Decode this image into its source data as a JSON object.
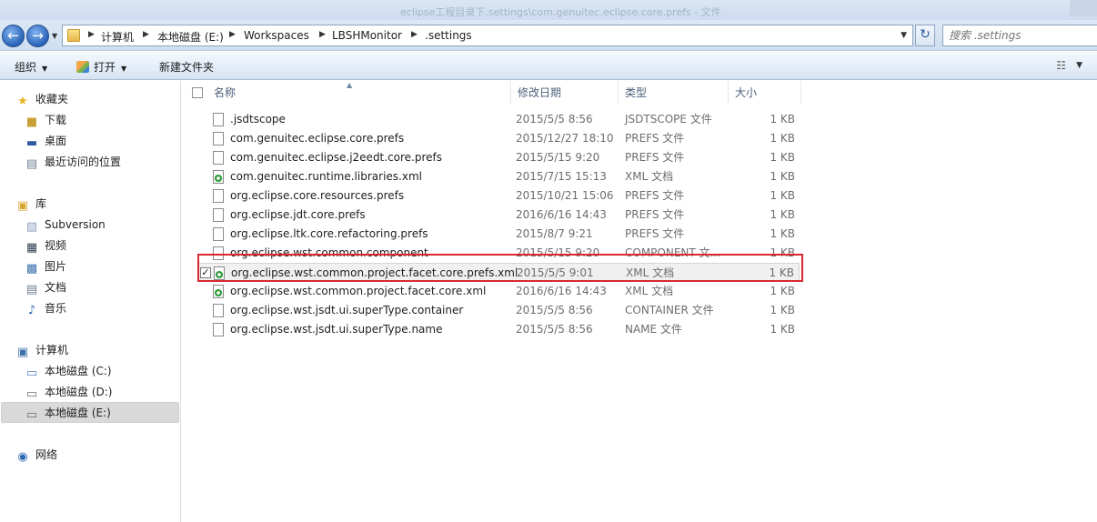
{
  "titlebar": {
    "title": "eclipse工程目录下.settings\\com.genuitec.eclipse.core.prefs - 文件"
  },
  "address": {
    "crumbs": [
      "计算机",
      "本地磁盘 (E:)",
      "Workspaces",
      "LBSHMonitor",
      ".settings"
    ]
  },
  "search": {
    "placeholder": "搜索 .settings"
  },
  "commands": {
    "organize": "组织",
    "open": "打开",
    "new_folder": "新建文件夹"
  },
  "nav": {
    "favorites": "收藏夹",
    "downloads": "下载",
    "desktop": "桌面",
    "recent": "最近访问的位置",
    "libraries": "库",
    "subversion": "Subversion",
    "videos": "视频",
    "pictures": "图片",
    "documents": "文档",
    "music": "音乐",
    "computer": "计算机",
    "drive_c": "本地磁盘 (C:)",
    "drive_d": "本地磁盘 (D:)",
    "drive_e": "本地磁盘 (E:)",
    "network": "网络"
  },
  "columns": {
    "name": "名称",
    "date": "修改日期",
    "type": "类型",
    "size": "大小"
  },
  "files": [
    {
      "name": ".jsdtscope",
      "date": "2015/5/5 8:56",
      "type": "JSDTSCOPE 文件",
      "size": "1 KB",
      "icon": "file-icon"
    },
    {
      "name": "com.genuitec.eclipse.core.prefs",
      "date": "2015/12/27 18:10",
      "type": "PREFS 文件",
      "size": "1 KB",
      "icon": "file-icon"
    },
    {
      "name": "com.genuitec.eclipse.j2eedt.core.prefs",
      "date": "2015/5/15 9:20",
      "type": "PREFS 文件",
      "size": "1 KB",
      "icon": "file-icon"
    },
    {
      "name": "com.genuitec.runtime.libraries.xml",
      "date": "2015/7/15 15:13",
      "type": "XML 文档",
      "size": "1 KB",
      "icon": "xml-icon"
    },
    {
      "name": "org.eclipse.core.resources.prefs",
      "date": "2015/10/21 15:06",
      "type": "PREFS 文件",
      "size": "1 KB",
      "icon": "file-icon"
    },
    {
      "name": "org.eclipse.jdt.core.prefs",
      "date": "2016/6/16 14:43",
      "type": "PREFS 文件",
      "size": "1 KB",
      "icon": "file-icon"
    },
    {
      "name": "org.eclipse.ltk.core.refactoring.prefs",
      "date": "2015/8/7 9:21",
      "type": "PREFS 文件",
      "size": "1 KB",
      "icon": "file-icon"
    },
    {
      "name": "org.eclipse.wst.common.component",
      "date": "2015/5/15 9:20",
      "type": "COMPONENT 文...",
      "size": "1 KB",
      "icon": "file-icon"
    },
    {
      "name": "org.eclipse.wst.common.project.facet.core.prefs.xml",
      "date": "2015/5/5 9:01",
      "type": "XML 文档",
      "size": "1 KB",
      "icon": "xml-icon"
    },
    {
      "name": "org.eclipse.wst.common.project.facet.core.xml",
      "date": "2016/6/16 14:43",
      "type": "XML 文档",
      "size": "1 KB",
      "icon": "xml-icon"
    },
    {
      "name": "org.eclipse.wst.jsdt.ui.superType.container",
      "date": "2015/5/5 8:56",
      "type": "CONTAINER 文件",
      "size": "1 KB",
      "icon": "file-icon"
    },
    {
      "name": "org.eclipse.wst.jsdt.ui.superType.name",
      "date": "2015/5/5 8:56",
      "type": "NAME 文件",
      "size": "1 KB",
      "icon": "file-icon"
    }
  ],
  "selection": {
    "checkmark": "✓"
  },
  "colors": {
    "highlight": "#d9292f",
    "accent": "#2b64b8"
  }
}
